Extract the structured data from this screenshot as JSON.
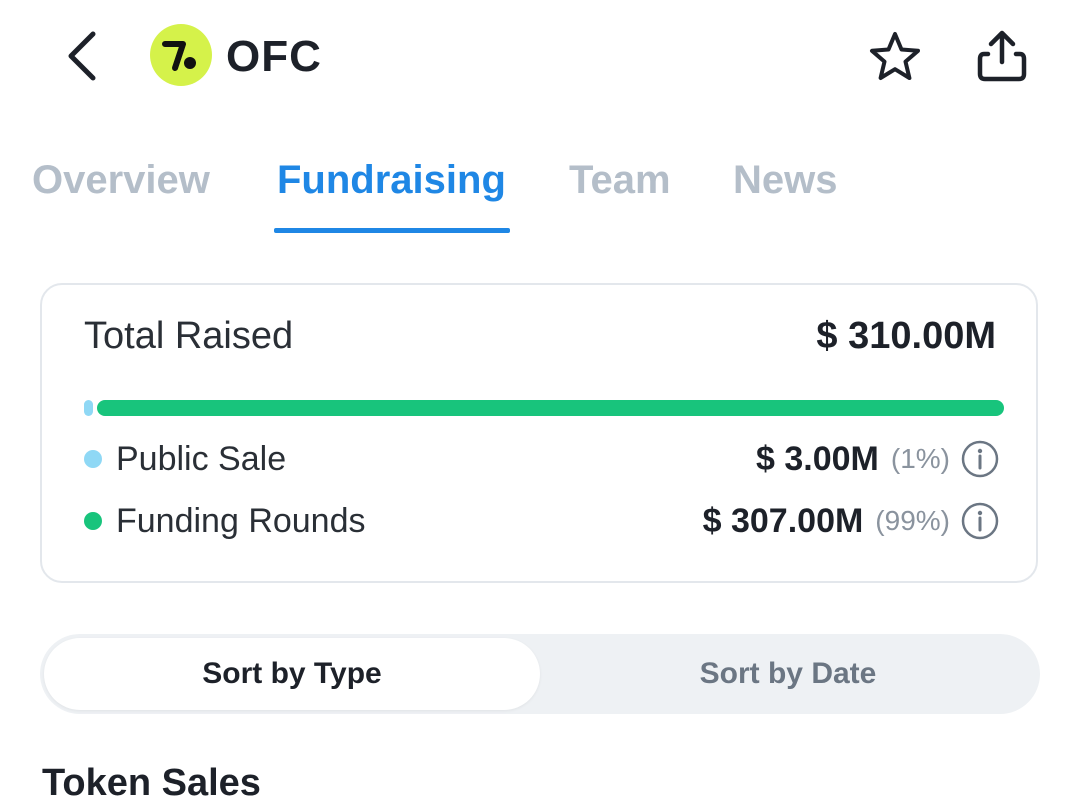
{
  "header": {
    "symbol": "OFC",
    "icons": {
      "back": "chevron-left-icon",
      "logo": "ofc-logo",
      "favorite": "star-icon",
      "share": "share-icon"
    }
  },
  "tabs": [
    {
      "label": "Overview",
      "active": false
    },
    {
      "label": "Fundraising",
      "active": true
    },
    {
      "label": "Team",
      "active": false
    },
    {
      "label": "News",
      "active": false
    }
  ],
  "summary": {
    "total_label": "Total Raised",
    "total_value": "$ 310.00M",
    "breakdown": [
      {
        "label": "Public Sale",
        "value": "$ 3.00M",
        "percent_text": "(1%)",
        "share": 0.01,
        "color": "#8fd8f5"
      },
      {
        "label": "Funding Rounds",
        "value": "$ 307.00M",
        "percent_text": "(99%)",
        "share": 0.99,
        "color": "#18c47c"
      }
    ]
  },
  "sort_toggle": {
    "options": [
      "Sort by Type",
      "Sort by Date"
    ],
    "selected": "Sort by Type"
  },
  "section": {
    "title": "Token Sales"
  },
  "colors": {
    "accent": "#1f87e5",
    "logo_bg": "#d5f24a",
    "tab_inactive": "#b4bec9"
  }
}
